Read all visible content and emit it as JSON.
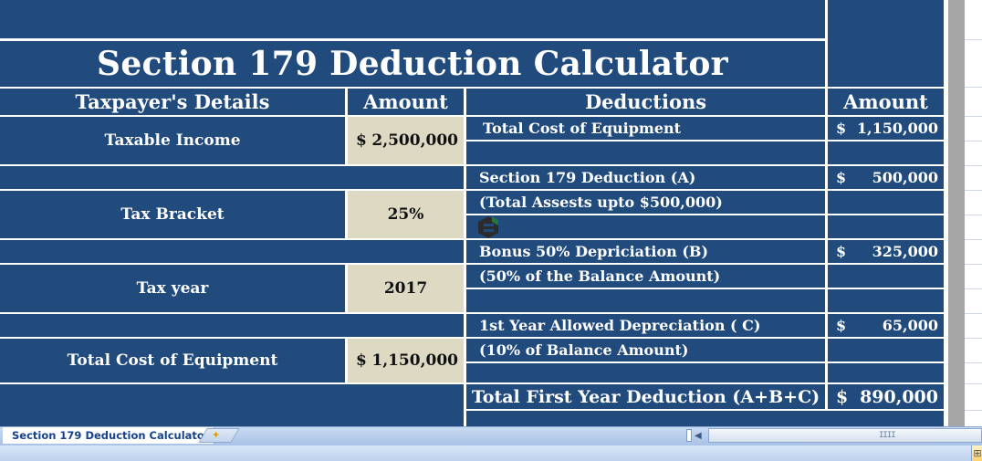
{
  "title": "Section 179 Deduction Calculator",
  "left_table": {
    "headers": {
      "details": "Taxpayer's Details",
      "amount": "Amount"
    },
    "rows": [
      {
        "label": "Taxable Income",
        "currency": "$",
        "value": "2,500,000"
      },
      {
        "label": "Tax Bracket",
        "currency": "",
        "value": "25%"
      },
      {
        "label": "Tax year",
        "currency": "",
        "value": "2017"
      },
      {
        "label": "Total Cost of Equipment",
        "currency": "$",
        "value": "1,150,000"
      }
    ]
  },
  "right_table": {
    "headers": {
      "deductions": "Deductions",
      "amount": "Amount"
    },
    "rows": [
      {
        "label": "Total Cost of Equipment",
        "currency": "$",
        "value": "1,150,000"
      },
      {
        "label": "Section 179 Deduction (A)",
        "currency": "$",
        "value": "500,000"
      },
      {
        "label": "(Total Assests upto $500,000)"
      },
      {
        "label": "Bonus 50% Depriciation (B)",
        "currency": "$",
        "value": "325,000"
      },
      {
        "label": "(50% of the Balance Amount)"
      },
      {
        "label": "1st Year Allowed Depreciation ( C)",
        "currency": "$",
        "value": "65,000"
      },
      {
        "label": "(10% of Balance Amount)"
      }
    ],
    "total": {
      "label": "Total First Year Deduction (A+B+C)",
      "currency": "$",
      "value": "890,000"
    }
  },
  "sheet_tabs": [
    {
      "label": "Section 179 Deduction Calculato",
      "active": true
    }
  ],
  "icons": {
    "new_sheet": "insert-worksheet-icon",
    "scroll_left": "scroll-left-arrow-icon",
    "grip": "IIII",
    "view": "⊞"
  },
  "colors": {
    "header_bg": "#214a7d",
    "input_bg": "#ddd9c3",
    "text_light": "#ffffff"
  }
}
